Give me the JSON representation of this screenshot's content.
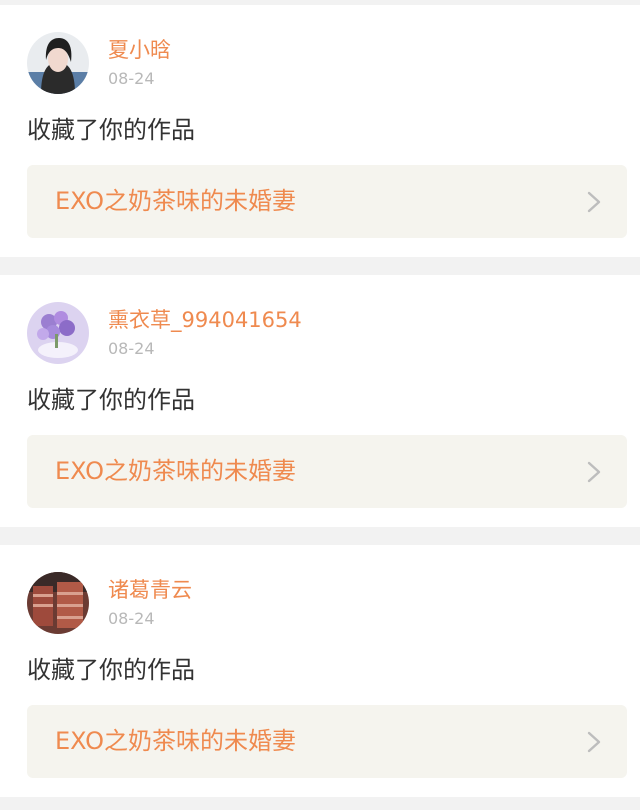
{
  "notifications": [
    {
      "username": "夏小晗",
      "date": "08-24",
      "action": "收藏了你的作品",
      "work_title": "EXO之奶茶味的未婚妻"
    },
    {
      "username": "熏衣草_994041654",
      "date": "08-24",
      "action": "收藏了你的作品",
      "work_title": "EXO之奶茶味的未婚妻"
    },
    {
      "username": "诸葛青云",
      "date": "08-24",
      "action": "收藏了你的作品",
      "work_title": "EXO之奶茶味的未婚妻"
    }
  ],
  "colors": {
    "accent": "#ef8a4f",
    "date_text": "#b8b8b8",
    "body_text": "#333333",
    "link_bg": "#f5f4ee",
    "page_bg": "#f2f2f2"
  },
  "icons": {
    "chevron": "chevron-right-icon"
  }
}
